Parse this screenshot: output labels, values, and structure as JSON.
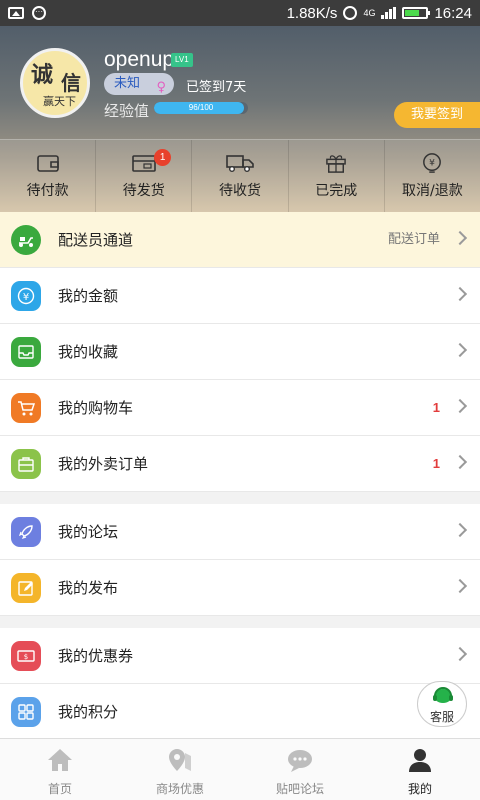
{
  "status_bar": {
    "speed": "1.88K/s",
    "network": "4G",
    "time": "16:24"
  },
  "profile": {
    "avatar_text": [
      "诚",
      "信",
      "赢天下"
    ],
    "username": "openup",
    "level": "LV1",
    "gender_tag": "未知",
    "checkin_status": "已签到7天",
    "exp_label": "经验值",
    "exp_text": "96/100",
    "exp_fraction": 0.96,
    "checkin_button": "我要签到"
  },
  "orders": [
    {
      "label": "待付款",
      "icon": "wallet-icon"
    },
    {
      "label": "待发货",
      "icon": "card-icon",
      "badge": "1"
    },
    {
      "label": "待收货",
      "icon": "truck-icon"
    },
    {
      "label": "已完成",
      "icon": "gift-icon"
    },
    {
      "label": "取消/退款",
      "icon": "refund-icon"
    }
  ],
  "menu": {
    "courier": {
      "label": "配送员通道",
      "right": "配送订单",
      "icon": "scooter-icon",
      "color": "#3aa93e"
    },
    "balance": {
      "label": "我的金额",
      "icon": "yuan-icon",
      "color": "#2da6e8"
    },
    "favorites": {
      "label": "我的收藏",
      "icon": "inbox-icon",
      "color": "#3aa93e"
    },
    "cart": {
      "label": "我的购物车",
      "count": "1",
      "icon": "cart-icon",
      "color": "#f07a25"
    },
    "takeout": {
      "label": "我的外卖订单",
      "count": "1",
      "icon": "bag-icon",
      "color": "#8bc34a"
    },
    "forum": {
      "label": "我的论坛",
      "icon": "rocket-icon",
      "color": "#6d7fe0"
    },
    "posts": {
      "label": "我的发布",
      "icon": "edit-icon",
      "color": "#f4b52a"
    },
    "coupons": {
      "label": "我的优惠券",
      "icon": "ticket-icon",
      "color": "#e54d57"
    },
    "points": {
      "label": "我的积分",
      "icon": "grid-icon",
      "color": "#5ba2ea"
    }
  },
  "service": {
    "label": "客服"
  },
  "tabs": [
    {
      "label": "首页",
      "icon": "home-icon"
    },
    {
      "label": "商场优惠",
      "icon": "location-icon"
    },
    {
      "label": "贴吧论坛",
      "icon": "chat-icon"
    },
    {
      "label": "我的",
      "icon": "user-icon"
    }
  ]
}
